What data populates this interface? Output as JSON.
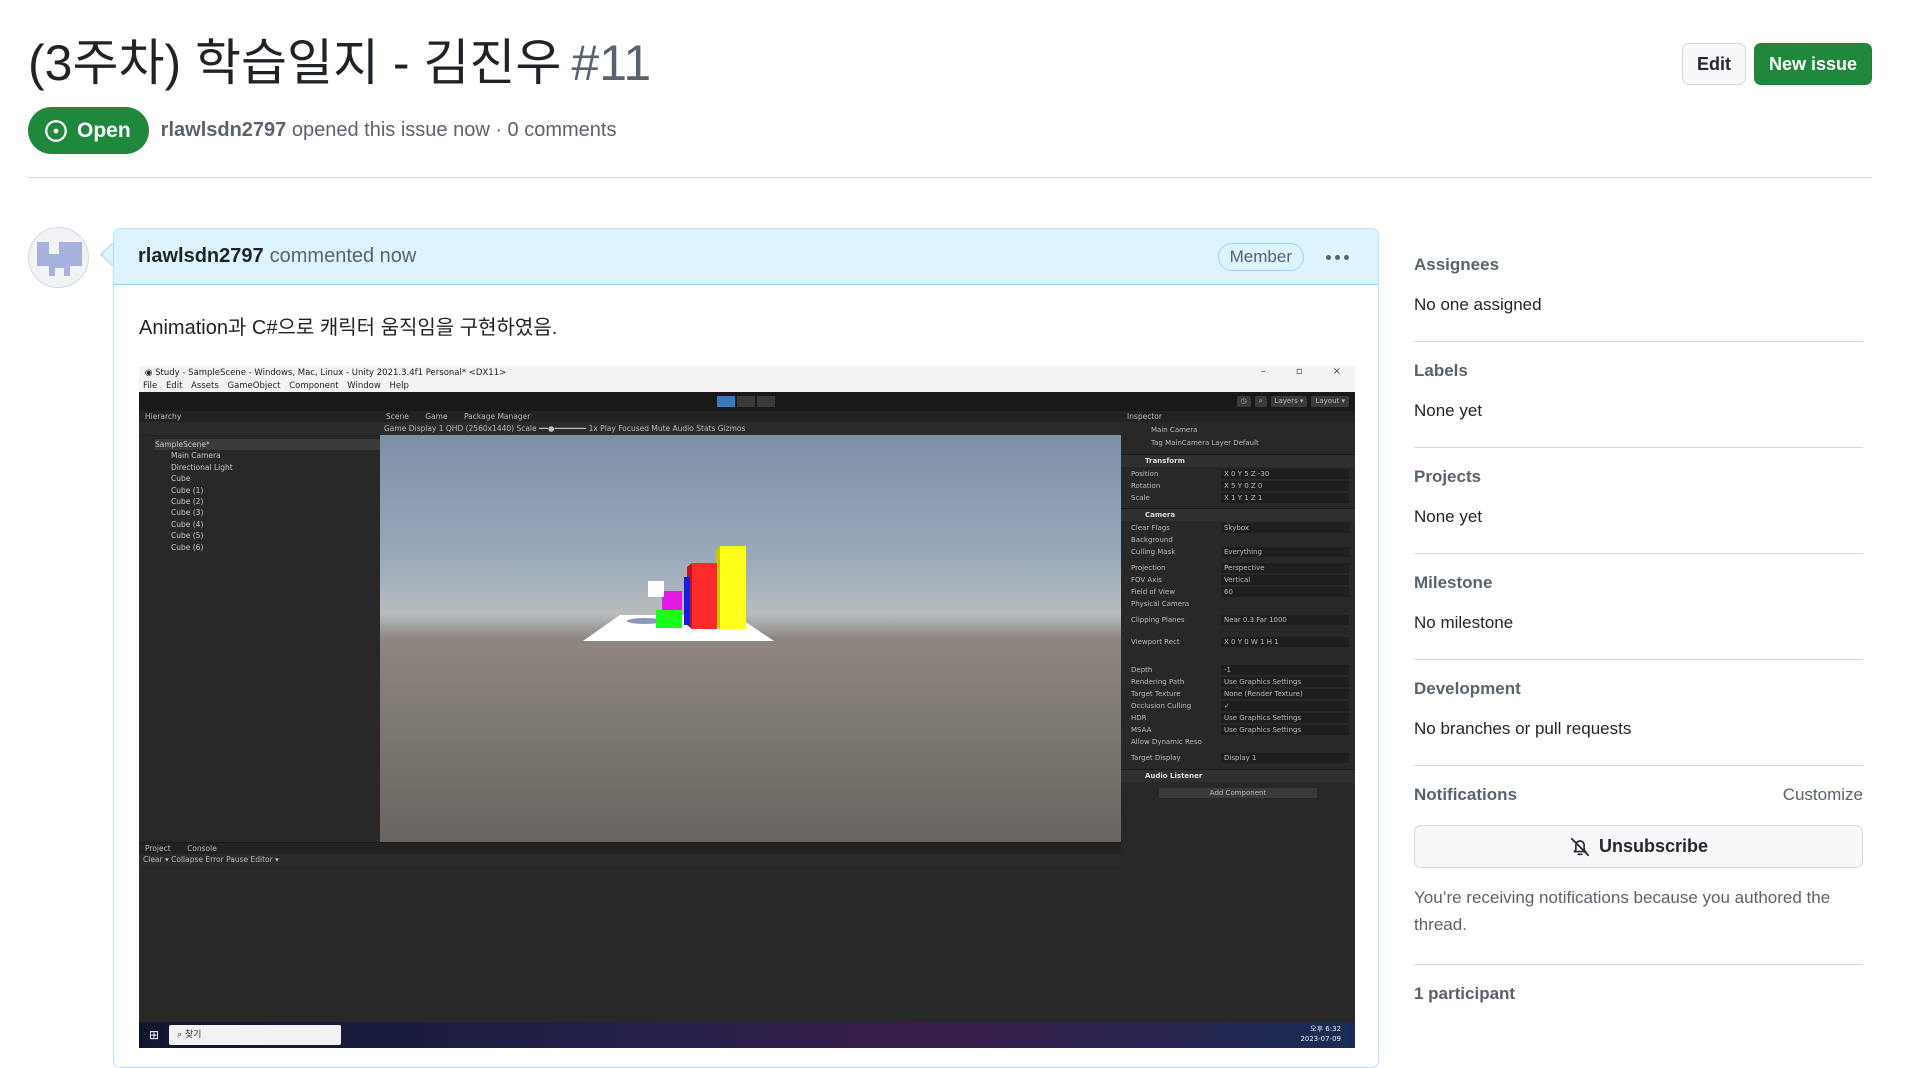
{
  "issue": {
    "title": "(3주차) 학습일지 - 김진우",
    "number": "#11",
    "state": "Open",
    "author": "rlawlsdn2797",
    "opened_text": "opened this issue now · 0 comments"
  },
  "header_buttons": {
    "edit": "Edit",
    "new_issue": "New issue"
  },
  "comment": {
    "author": "rlawlsdn2797",
    "when": "commented now",
    "badge": "Member",
    "body": "Animation과 C#으로 캐릭터 움직임을 구현하였음."
  },
  "screenshot": {
    "window_title": "Study - SampleScene - Windows, Mac, Linux - Unity 2021.3.4f1 Personal* <DX11>",
    "menu": [
      "File",
      "Edit",
      "Assets",
      "GameObject",
      "Component",
      "Window",
      "Help"
    ],
    "hierarchy_tab": "Hierarchy",
    "hierarchy_items": [
      "SampleScene*",
      "Main Camera",
      "Directional Light",
      "Cube",
      "Cube (1)",
      "Cube (2)",
      "Cube (3)",
      "Cube (4)",
      "Cube (5)",
      "Cube (6)"
    ],
    "game_tabs": [
      "Scene",
      "Game",
      "Package Manager"
    ],
    "game_bar": "Game   Display 1   QHD (2560x1440)   Scale ━━●━━━━━━━ 1x                                                            Play Focused   Mute Audio   Stats   Gizmos",
    "inspector_tab": "Inspector",
    "inspector_object": "Main Camera",
    "inspector_tag": "Tag MainCamera    Layer Default",
    "transform_header": "Transform",
    "transform_rows": [
      {
        "label": "Position",
        "value": "X 0    Y 5    Z -30"
      },
      {
        "label": "Rotation",
        "value": "X 5    Y 0    Z 0"
      },
      {
        "label": "Scale",
        "value": "X 1    Y 1    Z 1"
      }
    ],
    "camera_header": "Camera",
    "camera_rows": [
      {
        "label": "Clear Flags",
        "value": "Skybox"
      },
      {
        "label": "Background",
        "value": ""
      },
      {
        "label": "Culling Mask",
        "value": "Everything"
      },
      {
        "label": "Projection",
        "value": "Perspective"
      },
      {
        "label": "FOV Axis",
        "value": "Vertical"
      },
      {
        "label": "Field of View",
        "value": "60"
      },
      {
        "label": "Physical Camera",
        "value": ""
      },
      {
        "label": "Clipping Planes",
        "value": "Near 0.3   Far 1000"
      },
      {
        "label": "Viewport Rect",
        "value": "X 0  Y 0  W 1  H 1"
      },
      {
        "label": "Depth",
        "value": "-1"
      },
      {
        "label": "Rendering Path",
        "value": "Use Graphics Settings"
      },
      {
        "label": "Target Texture",
        "value": "None (Render Texture)"
      },
      {
        "label": "Occlusion Culling",
        "value": "✓"
      },
      {
        "label": "HDR",
        "value": "Use Graphics Settings"
      },
      {
        "label": "MSAA",
        "value": "Use Graphics Settings"
      },
      {
        "label": "Allow Dynamic Reso",
        "value": ""
      },
      {
        "label": "Target Display",
        "value": "Display 1"
      }
    ],
    "audio_header": "Audio Listener",
    "add_component": "Add Component",
    "bottom_tabs": [
      "Project",
      "Console"
    ],
    "console_bar": "Clear ▾  Collapse  Error Pause  Editor ▾",
    "taskbar_search": "찾기",
    "tray_time": "오후 6:32",
    "tray_date": "2023-07-09",
    "colors": {
      "cube_red": "#ff2a2a",
      "cube_yellow": "#ffff1a",
      "cube_green": "#1aff1a",
      "cube_magenta": "#e01ae0",
      "cube_blue": "#1a1ae0",
      "cube_white": "#ffffff"
    }
  },
  "sidebar": {
    "assignees": {
      "label": "Assignees",
      "value": "No one assigned"
    },
    "labels": {
      "label": "Labels",
      "value": "None yet"
    },
    "projects": {
      "label": "Projects",
      "value": "None yet"
    },
    "milestone": {
      "label": "Milestone",
      "value": "No milestone"
    },
    "development": {
      "label": "Development",
      "value": "No branches or pull requests"
    },
    "notifications": {
      "label": "Notifications",
      "customize": "Customize",
      "unsubscribe": "Unsubscribe",
      "reason": "You’re receiving notifications because you authored the thread."
    },
    "participants": "1 participant"
  }
}
